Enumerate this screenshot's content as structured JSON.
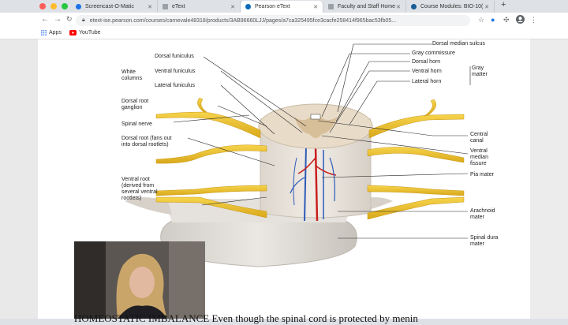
{
  "browser": {
    "tabs": [
      {
        "title": "Screencast-O-Matic",
        "favicon_color": "#1a73e8"
      },
      {
        "title": "eText",
        "favicon_color": "#555555"
      },
      {
        "title": "Pearson eText",
        "favicon_color": "#0b6bb8"
      },
      {
        "title": "Faculty and Staff Home",
        "favicon_color": "#555555"
      },
      {
        "title": "Course Modules: BIO-10(",
        "favicon_color": "#1a5c96"
      }
    ],
    "new_tab": "+",
    "url": "etext-ise.pearson.com/courses/carnevale48318/products/3AB96660LJJ/pages/a7ca325495fce3cacfe258414f965bac53fb05...",
    "bookmarks": [
      {
        "label": "Apps",
        "icon": "apps-grid-icon"
      },
      {
        "label": "YouTube",
        "icon": "youtube-icon"
      }
    ]
  },
  "figure": {
    "labels_left": {
      "white_columns": "White columns",
      "dorsal_funiculus": "Dorsal funiculus",
      "ventral_funiculus": "Ventral funiculus",
      "lateral_funiculus": "Lateral funiculus",
      "dorsal_root_ganglion": "Dorsal root ganglion",
      "spinal_nerve": "Spinal nerve",
      "dorsal_root": "Dorsal root (fans out into dorsal rootlets)",
      "ventral_root": "Ventral root (derived from several ventral rootlets)"
    },
    "labels_right": {
      "dorsal_median_sulcus": "Dorsal median sulcus",
      "gray_commissure": "Gray commissure",
      "dorsal_horn": "Dorsal horn",
      "ventral_horn": "Ventral horn",
      "lateral_horn": "Lateral horn",
      "gray_matter": "Gray matter",
      "central_canal": "Central canal",
      "ventral_median_fissure": "Ventral median fissure",
      "pia_mater": "Pia mater",
      "arachnoid_mater": "Arachnoid mater",
      "spinal_dura_mater": "Spinal dura mater"
    }
  },
  "bottom_text": "HOMEOSTATIC IMBALANCE Even though the spinal cord is protected by menin"
}
